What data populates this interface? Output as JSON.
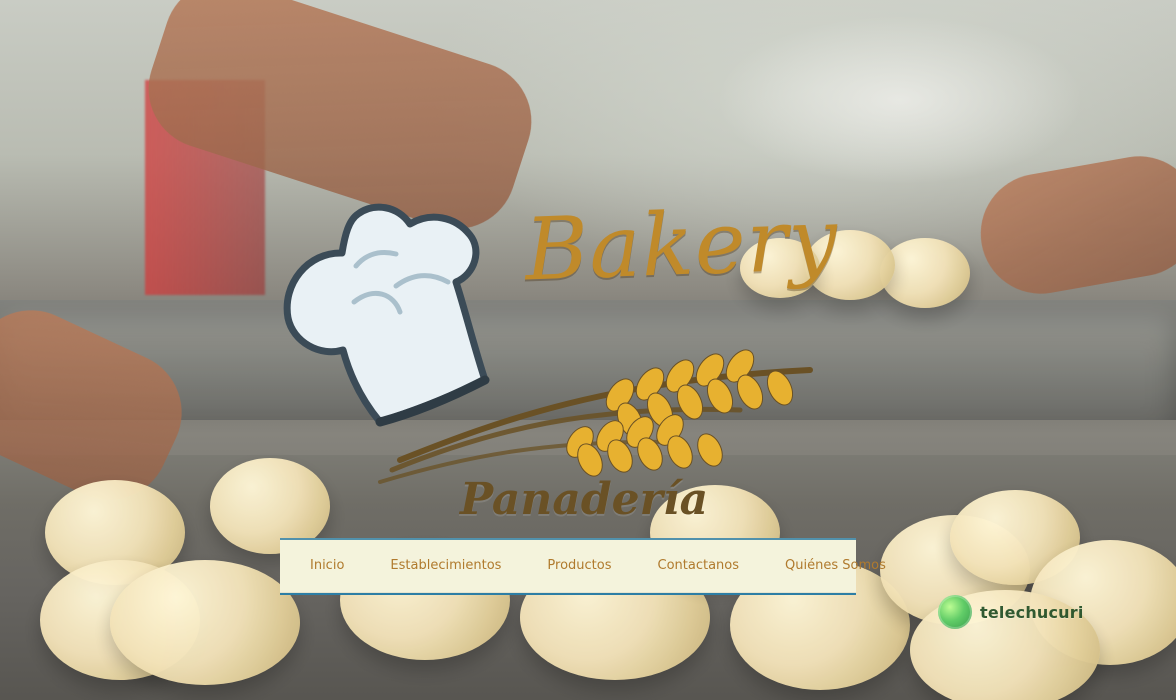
{
  "logo": {
    "brand": "Bakery",
    "subtitle": "Panadería"
  },
  "nav": {
    "items": [
      {
        "label": "Inicio"
      },
      {
        "label": "Establecimientos"
      },
      {
        "label": "Productos"
      },
      {
        "label": "Contactanos"
      },
      {
        "label": "Quiénes Somos"
      }
    ]
  },
  "watermark": {
    "text": "telechucuri"
  },
  "colors": {
    "brand_gold": "#c08a2a",
    "brand_brown": "#6a5125",
    "nav_bg": "#f4f3dc",
    "nav_text": "#b07a2d",
    "nav_border": "#2d7ea5"
  }
}
